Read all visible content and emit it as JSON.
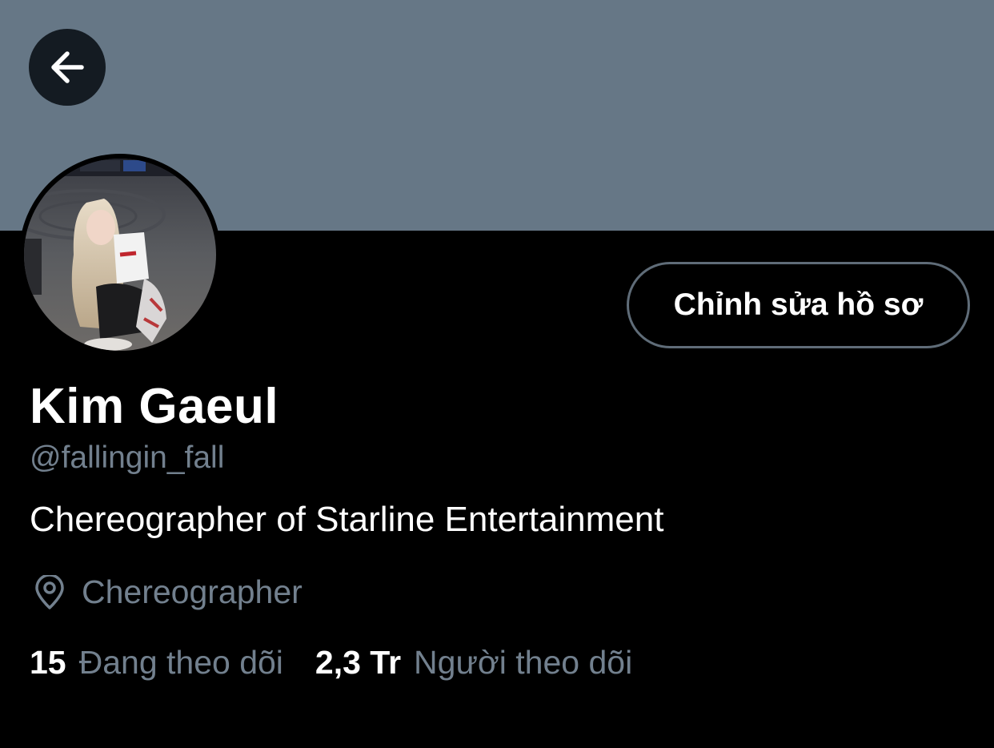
{
  "profile": {
    "display_name": "Kim Gaeul",
    "handle": "@fallingin_fall",
    "bio": "Chereographer of Starline Entertainment",
    "location": "Chereographer",
    "edit_button_label": "Chỉnh sửa hồ sơ"
  },
  "stats": {
    "following_count": "15",
    "following_label": "Đang theo dõi",
    "followers_count": "2,3 Tr",
    "followers_label": "Người theo dõi"
  },
  "icons": {
    "back": "arrow-left-icon",
    "location": "location-pin-icon"
  },
  "colors": {
    "banner": "#667786",
    "background": "#000000",
    "secondary_text": "#72808e",
    "button_border": "#5f6c78"
  }
}
